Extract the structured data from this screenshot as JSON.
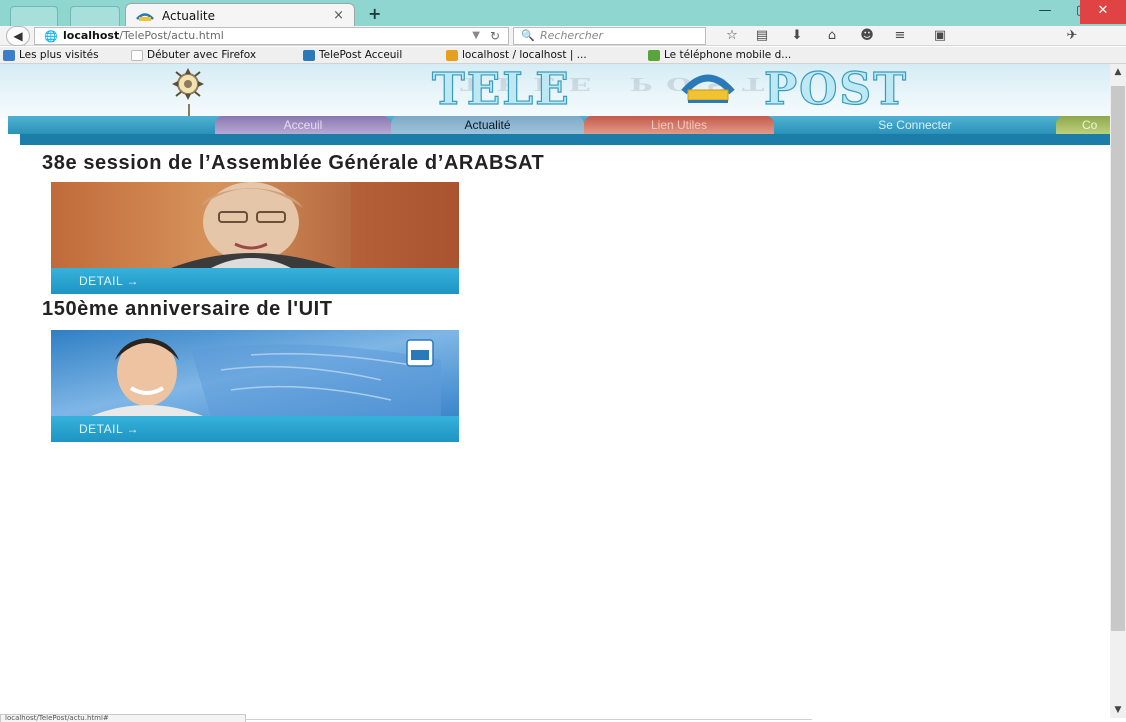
{
  "browser": {
    "tab_title": "Actualite",
    "tab_close": "×",
    "new_tab": "+",
    "window_controls": {
      "minimize": "—",
      "maximize": "▢",
      "close": "✕"
    },
    "url_host": "localhost",
    "url_path": "/TelePost/actu.html",
    "search_placeholder": "Rechercher",
    "bookmarks": [
      {
        "label": "Les plus visités",
        "icon": "most-visited-icon",
        "color": "#3a7dc9"
      },
      {
        "label": "Débuter avec Firefox",
        "icon": "page-icon",
        "color": "#cfcfcf"
      },
      {
        "label": "TelePost Acceuil",
        "icon": "telepost-icon",
        "color": "#2a79b8"
      },
      {
        "label": "localhost / localhost | ...",
        "icon": "phpmyadmin-icon",
        "color": "#e6a020"
      },
      {
        "label": "Le téléphone mobile d...",
        "icon": "mobile-site-icon",
        "color": "#58a53b"
      }
    ],
    "status_text": "localhost/TelePost/actu.html#"
  },
  "site": {
    "logo_left": "TELE",
    "logo_right": "POST",
    "menu": [
      {
        "label": "Acceuil",
        "key": "accueil"
      },
      {
        "label": "Actualité",
        "key": "actu"
      },
      {
        "label": "Lien Utiles",
        "key": "liens"
      },
      {
        "label": "Se Connecter",
        "key": "connect"
      },
      {
        "label": "Co",
        "key": "co"
      }
    ]
  },
  "articles": [
    {
      "title": "38e session de l’Assemblée Générale d’ARABSAT",
      "detail_label": "DETAIL →"
    },
    {
      "title": "150ème anniversaire de l'UIT",
      "detail_label": "DETAIL →"
    }
  ],
  "colors": {
    "titlebar": "#8fd6d1",
    "menubar": "#2a92b8",
    "detail_bar": "#2aa4d0",
    "close_button": "#e04343"
  }
}
